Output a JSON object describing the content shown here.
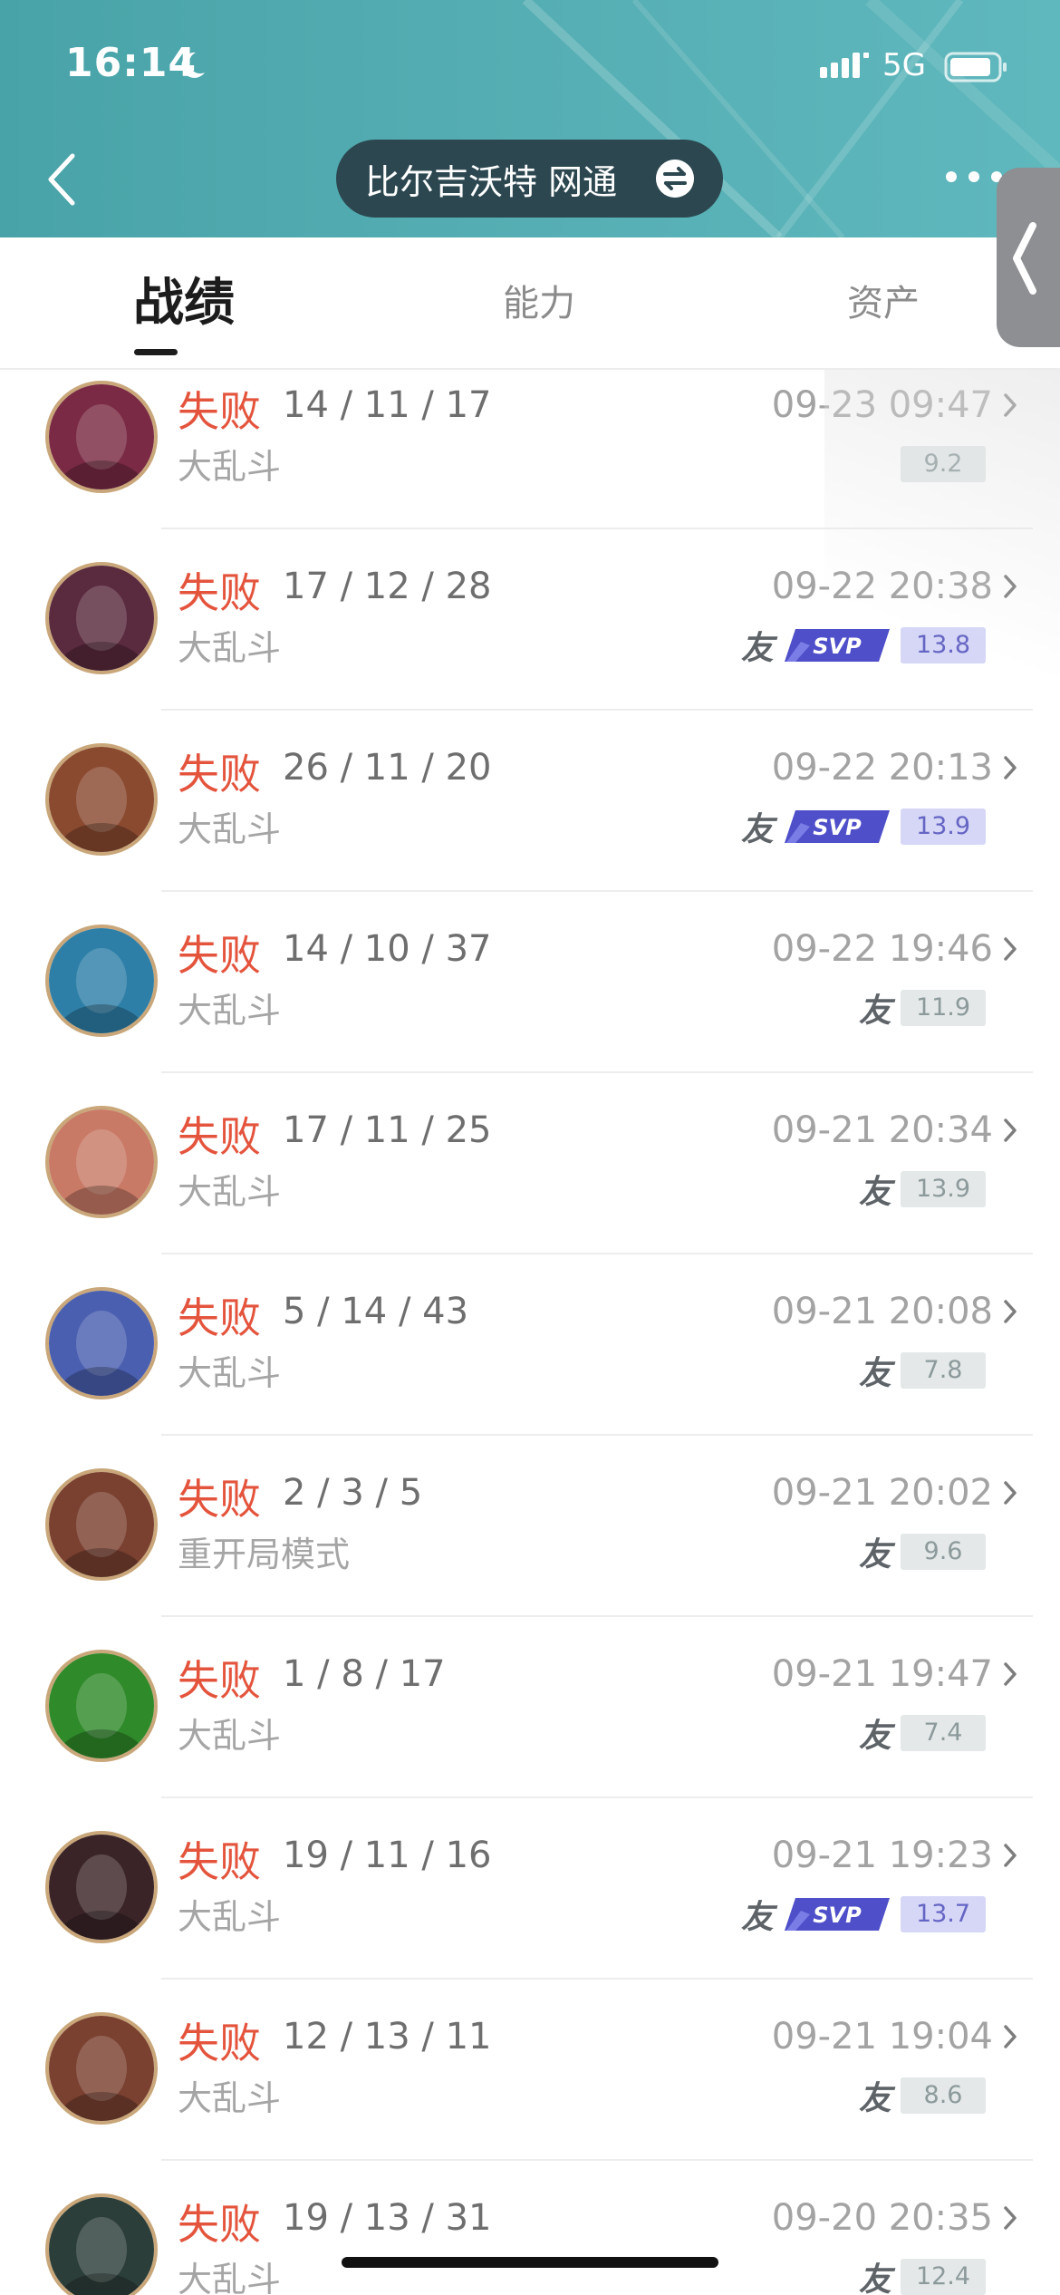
{
  "status_bar": {
    "time": "16:14",
    "network": "5G"
  },
  "header": {
    "server_name": "比尔吉沃特 网通",
    "icons": [
      "chevron-left-icon",
      "switch-icon",
      "more-icon",
      "side-handle-chevron-icon"
    ]
  },
  "tabs": [
    {
      "label": "战绩",
      "active": true
    },
    {
      "label": "能力",
      "active": false
    },
    {
      "label": "资产",
      "active": false
    }
  ],
  "matches": [
    {
      "result": "失败",
      "kda": "14 / 11 / 17",
      "mode": "大乱斗",
      "date": "09-23 09:47",
      "friend": false,
      "svp": false,
      "score": "9.2",
      "avatar_color": "#7a2a44"
    },
    {
      "result": "失败",
      "kda": "17 / 12 / 28",
      "mode": "大乱斗",
      "date": "09-22 20:38",
      "friend": true,
      "svp": true,
      "score": "13.8",
      "avatar_color": "#5a2a3e"
    },
    {
      "result": "失败",
      "kda": "26 / 11 / 20",
      "mode": "大乱斗",
      "date": "09-22 20:13",
      "friend": true,
      "svp": true,
      "score": "13.9",
      "avatar_color": "#8a4a30"
    },
    {
      "result": "失败",
      "kda": "14 / 10 / 37",
      "mode": "大乱斗",
      "date": "09-22 19:46",
      "friend": true,
      "svp": false,
      "score": "11.9",
      "avatar_color": "#2e7fa8"
    },
    {
      "result": "失败",
      "kda": "17 / 11 / 25",
      "mode": "大乱斗",
      "date": "09-21 20:34",
      "friend": true,
      "svp": false,
      "score": "13.9",
      "avatar_color": "#c97a66"
    },
    {
      "result": "失败",
      "kda": "5 / 14 / 43",
      "mode": "大乱斗",
      "date": "09-21 20:08",
      "friend": true,
      "svp": false,
      "score": "7.8",
      "avatar_color": "#4a5fb0"
    },
    {
      "result": "失败",
      "kda": "2 / 3 / 5",
      "mode": "重开局模式",
      "date": "09-21 20:02",
      "friend": true,
      "svp": false,
      "score": "9.6",
      "avatar_color": "#7a4030"
    },
    {
      "result": "失败",
      "kda": "1 / 8 / 17",
      "mode": "大乱斗",
      "date": "09-21 19:47",
      "friend": true,
      "svp": false,
      "score": "7.4",
      "avatar_color": "#2f8a2a"
    },
    {
      "result": "失败",
      "kda": "19 / 11 / 16",
      "mode": "大乱斗",
      "date": "09-21 19:23",
      "friend": true,
      "svp": true,
      "score": "13.7",
      "avatar_color": "#3a2428"
    },
    {
      "result": "失败",
      "kda": "12 / 13 / 11",
      "mode": "大乱斗",
      "date": "09-21 19:04",
      "friend": true,
      "svp": false,
      "score": "8.6",
      "avatar_color": "#7a4030"
    },
    {
      "result": "失败",
      "kda": "19 / 13 / 31",
      "mode": "大乱斗",
      "date": "09-20 20:35",
      "friend": true,
      "svp": false,
      "score": "12.4",
      "avatar_color": "#2c3e3a"
    }
  ],
  "labels": {
    "friend": "友",
    "svp": "SVP"
  },
  "colors": {
    "header": "#54adb2",
    "loss": "#e4543d",
    "svp_score_bg": "#d6d7f7",
    "score_bg": "#e4e8e8"
  }
}
